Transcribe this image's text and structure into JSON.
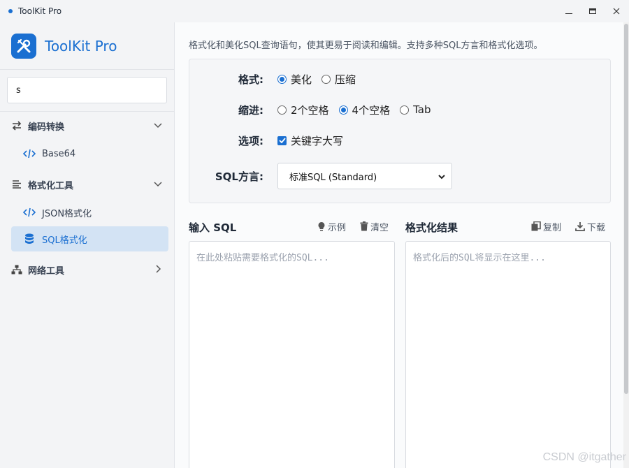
{
  "window": {
    "title": "ToolKit Pro"
  },
  "brand": {
    "name": "ToolKit Pro"
  },
  "search": {
    "value": "s"
  },
  "nav": {
    "groups": [
      {
        "label": "编码转换",
        "items": [
          {
            "label": "Base64"
          }
        ]
      },
      {
        "label": "格式化工具",
        "items": [
          {
            "label": "JSON格式化"
          },
          {
            "label": "SQL格式化"
          }
        ]
      },
      {
        "label": "网络工具",
        "items": []
      }
    ]
  },
  "main": {
    "description": "格式化和美化SQL查询语句，使其更易于阅读和编辑。支持多种SQL方言和格式化选项。",
    "options": {
      "format_label": "格式:",
      "format_beautify": "美化",
      "format_compress": "压缩",
      "indent_label": "缩进:",
      "indent_2": "2个空格",
      "indent_4": "4个空格",
      "indent_tab": "Tab",
      "extra_label": "选项:",
      "uppercase": "关键字大写",
      "dialect_label": "SQL方言:",
      "dialect_value": "标准SQL (Standard)"
    },
    "input": {
      "title": "输入 SQL",
      "example": "示例",
      "clear": "清空",
      "placeholder": "在此处粘贴需要格式化的SQL..."
    },
    "output": {
      "title": "格式化结果",
      "copy": "复制",
      "download": "下载",
      "placeholder": "格式化后的SQL将显示在这里..."
    }
  },
  "watermark": "CSDN @itgather"
}
